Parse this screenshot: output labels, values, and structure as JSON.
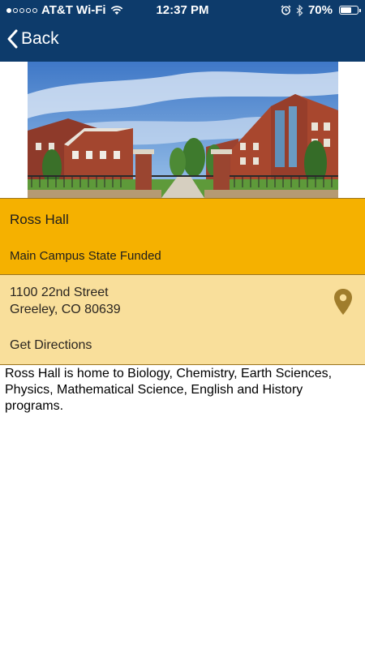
{
  "status_bar": {
    "carrier": "AT&T Wi-Fi",
    "time": "12:37 PM",
    "battery_percent": "70%",
    "battery_level": 0.7,
    "signal_bars_filled": 1,
    "signal_bars_total": 5,
    "icons": [
      "wifi-icon",
      "alarm-icon",
      "bluetooth-icon",
      "battery-icon"
    ]
  },
  "nav": {
    "back_label": "Back"
  },
  "building": {
    "name": "Ross Hall",
    "category": "Main Campus State Funded",
    "address_line1": "1100 22nd Street",
    "address_line2": "Greeley, CO  80639",
    "directions_label": "Get Directions",
    "description": "Ross Hall is home to Biology, Chemistry, Earth Sciences, Physics, Mathematical Science, English and History programs."
  },
  "colors": {
    "header_bg": "#0d3b6b",
    "title_bg": "#f5b100",
    "address_bg": "#f9df9b",
    "pin": "#a07d2c"
  }
}
